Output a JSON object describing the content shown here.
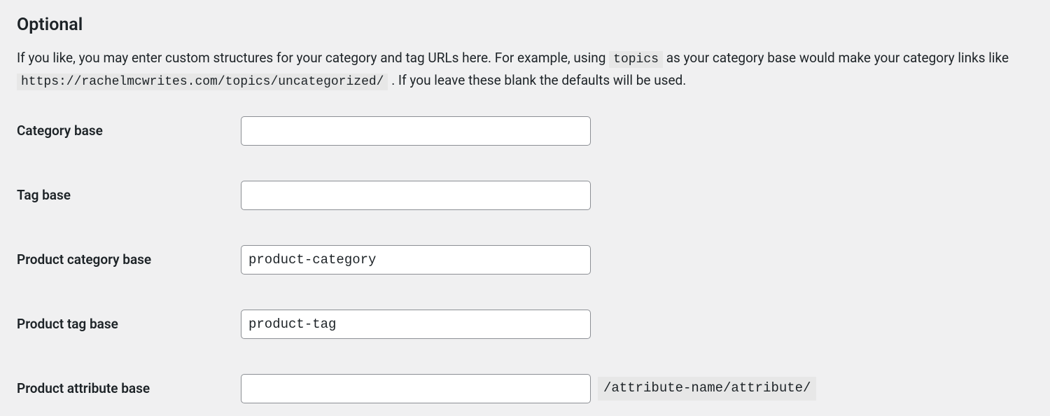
{
  "section": {
    "heading": "Optional",
    "desc_part1": "If you like, you may enter custom structures for your category and tag URLs here. For example, using ",
    "desc_code1": "topics",
    "desc_part2": " as your category base would make your category links like ",
    "desc_code2": "https://rachelmcwrites.com/topics/uncategorized/",
    "desc_part3": " . If you leave these blank the defaults will be used."
  },
  "fields": {
    "category_base": {
      "label": "Category base",
      "value": ""
    },
    "tag_base": {
      "label": "Tag base",
      "value": ""
    },
    "product_category_base": {
      "label": "Product category base",
      "value": "product-category"
    },
    "product_tag_base": {
      "label": "Product tag base",
      "value": "product-tag"
    },
    "product_attribute_base": {
      "label": "Product attribute base",
      "value": "",
      "suffix": "/attribute-name/attribute/"
    }
  }
}
